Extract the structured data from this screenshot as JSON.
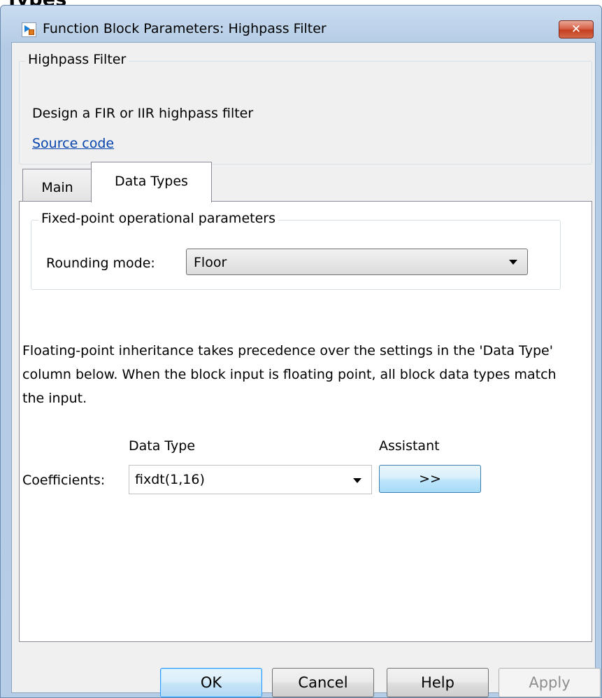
{
  "page": {
    "heading": "Types"
  },
  "window": {
    "title": "Function Block Parameters: Highpass Filter",
    "close_label": "✕"
  },
  "description": {
    "group_title": "Highpass Filter",
    "text": "Design a FIR or IIR highpass filter",
    "link": "Source code"
  },
  "tabs": [
    {
      "label": "Main",
      "selected": false
    },
    {
      "label": "Data Types",
      "selected": true
    }
  ],
  "fixed_point": {
    "group_title": "Fixed-point operational parameters",
    "rounding_label": "Rounding mode:",
    "rounding_value": "Floor"
  },
  "info_text": "Floating-point inheritance takes precedence over the settings in the 'Data Type' column below. When the block input is floating point, all block data types match the input.",
  "table": {
    "header_data_type": "Data Type",
    "header_assistant": "Assistant",
    "row_label": "Coefficients:",
    "row_value": "fixdt(1,16)",
    "assistant_button": ">>"
  },
  "buttons": {
    "ok": "OK",
    "cancel": "Cancel",
    "help": "Help",
    "apply": "Apply"
  }
}
